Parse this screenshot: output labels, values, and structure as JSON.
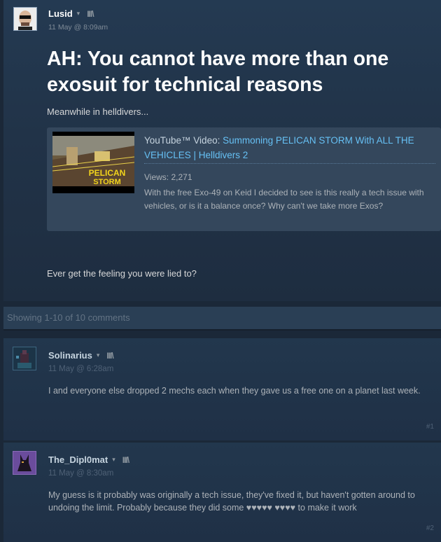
{
  "post": {
    "author": "Lusid",
    "date": "11 May @ 8:09am",
    "title": "AH: You cannot have more than one exosuit for technical reasons",
    "intro": "Meanwhile in helldivers...",
    "outro": "Ever get the feeling you were lied to?",
    "video": {
      "prefix": "YouTube™ Video: ",
      "title": "Summoning PELICAN STORM With ALL THE VEHICLES | Helldivers 2",
      "views": "Views: 2,271",
      "description": "With the free Exo-49 on Keid I decided to see is this really a tech issue with vehicles, or is it a balance once? Why can't we take more Exos?",
      "thumb_line1": "PELICAN",
      "thumb_line2": "STORM"
    }
  },
  "comments_summary": "Showing 1-10 of 10 comments",
  "comments": [
    {
      "author": "Solinarius",
      "date": "11 May @ 6:28am",
      "text": "I and everyone else dropped 2 mechs each when they gave us a free one on a planet last week.",
      "number": "#1"
    },
    {
      "author": "The_Dipl0mat",
      "date": "11 May @ 8:30am",
      "text": "My guess is it probably was originally a tech issue, they've fixed it, but haven't gotten around to undoing the limit. Probably because they did some ♥♥♥♥♥ ♥♥♥♥ to make it work",
      "number": "#2"
    }
  ],
  "icons": {
    "caret": "▾",
    "library": "ΙΙΙ\\"
  },
  "colors": {
    "background": "#1b2838",
    "link": "#66c0f4",
    "title": "#ffffff"
  }
}
